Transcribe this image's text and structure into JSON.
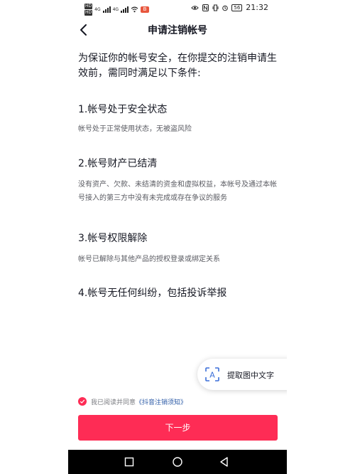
{
  "status_bar": {
    "left_sim1": "HD",
    "left_sim2": "HD",
    "sig1": "4G",
    "sig2": "4G",
    "app_badge": "B",
    "battery": "56",
    "time": "21:32"
  },
  "nav": {
    "title": "申请注销帐号"
  },
  "intro": "为保证你的帐号安全，在你提交的注销申请生效前，需同时满足以下条件:",
  "conditions": [
    {
      "heading": "1.帐号处于安全状态",
      "desc": "帐号处于正常使用状态，无被盗风险"
    },
    {
      "heading": "2.帐号财产已结清",
      "desc": "没有资产、欠款、未结清的资金和虚拟权益，本帐号及通过本帐号接入的第三方中没有未完成或存在争议的服务"
    },
    {
      "heading": "3.帐号权限解除",
      "desc": "帐号已解除与其他产品的授权登录或绑定关系"
    },
    {
      "heading": "4.帐号无任何纠纷，包括投诉举报",
      "desc": ""
    }
  ],
  "float_button": {
    "label": "提取图中文字",
    "icon_text": "A"
  },
  "agreement": {
    "text": "我已阅读并同意",
    "link": "《抖音注销须知》",
    "checked": true
  },
  "next_button": {
    "label": "下一步"
  },
  "colors": {
    "accent": "#fe2c55",
    "link": "#2b5aa6"
  }
}
